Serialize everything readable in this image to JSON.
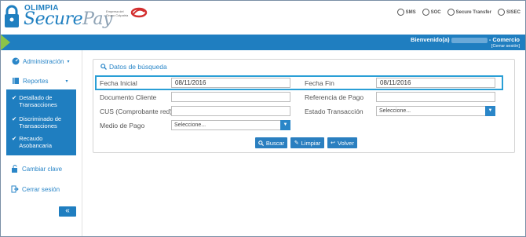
{
  "brand": {
    "small": "OLIMPIA",
    "big_1": "Secure",
    "big_2": "Pay",
    "group_text": "Empresa del Grupo Colpatria"
  },
  "certifications": [
    {
      "icon": "sms-cert-icon",
      "label": "SMS"
    },
    {
      "icon": "soc-cert-icon",
      "label": "SOC"
    },
    {
      "icon": "secure-transfer-icon",
      "label": "Secure Transfer"
    },
    {
      "icon": "sisec-icon",
      "label": "SISEC"
    }
  ],
  "topbar": {
    "welcome_prefix": "Bienvenido(a)",
    "welcome_suffix": "- Comercio",
    "logout": "[Cerrar sesión]"
  },
  "sidebar": {
    "administracion": "Administración",
    "reportes": "Reportes",
    "submenu": [
      "Detallado de Transacciones",
      "Discriminado de Transacciones",
      "Recaudo Asobancaria"
    ],
    "cambiar_clave": "Cambiar clave",
    "cerrar_sesion": "Cerrar sesión",
    "collapse": "«"
  },
  "form": {
    "title": "Datos de búsqueda",
    "fecha_inicial_label": "Fecha Inicial",
    "fecha_inicial_value": "08/11/2016",
    "fecha_fin_label": "Fecha Fin",
    "fecha_fin_value": "08/11/2016",
    "documento_label": "Documento Cliente",
    "referencia_label": "Referencia de Pago",
    "cus_label": "CUS (Comprobante red)",
    "estado_label": "Estado Transacción",
    "estado_value": "Seleccione...",
    "medio_label": "Medio de Pago",
    "medio_value": "Seleccione..."
  },
  "buttons": {
    "buscar": "Buscar",
    "limpiar": "Limpiar",
    "volver": "Volver"
  },
  "colors": {
    "primary": "#1f7ec0",
    "accent": "#8bc34a",
    "highlight": "#2a9fd6"
  }
}
